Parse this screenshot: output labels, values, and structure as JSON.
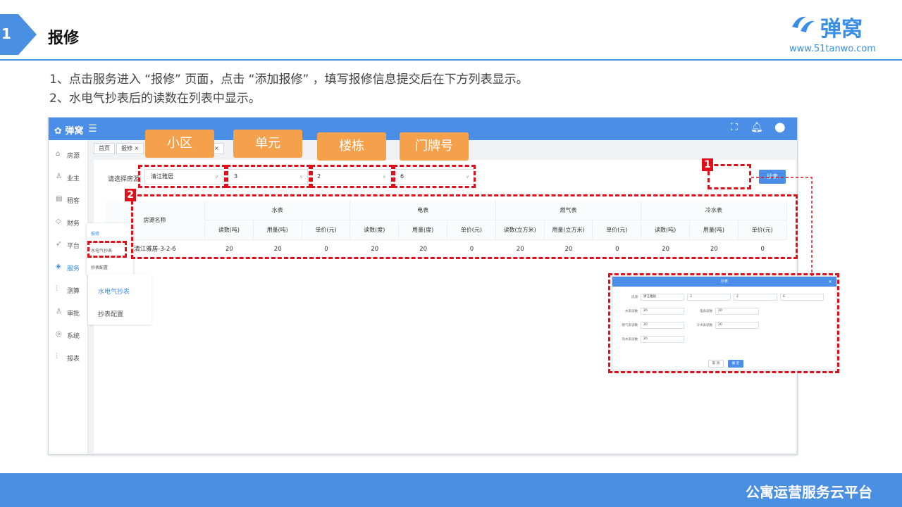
{
  "slide": {
    "number": "1",
    "title": "报修",
    "logo_name": "弹窝",
    "logo_url": "www.51tanwo.com",
    "notes": [
      "1、点击服务进入 “报修” 页面，点击 “添加报修” ，填写报修信息提交后在下方列表显示。",
      "2、水电气抄表后的读数在列表中显示。"
    ],
    "footer": "公寓运营服务云平台"
  },
  "tags": [
    "小区",
    "单元",
    "楼栋",
    "门牌号"
  ],
  "badges": [
    "1",
    "2"
  ],
  "app": {
    "brand": "弹窝",
    "sidebar": [
      "房源",
      "业主",
      "租客",
      "财务",
      "平台",
      "服务",
      "测算",
      "审批",
      "系统",
      "报表"
    ],
    "sidebar_icons": [
      "home-icon",
      "user-icon",
      "database-icon",
      "diamond-icon",
      "send-icon",
      "tag-icon",
      "sliders-icon",
      "person-icon",
      "settings-icon",
      "sliders-icon"
    ],
    "breadcrumbs": [
      "首页",
      "报修 ×",
      "×"
    ],
    "filter": {
      "label": "请选择房源",
      "community": "清江雅居",
      "unit": "3",
      "building": "2",
      "room": "6"
    },
    "buttons": {
      "meter": "抄表"
    },
    "popmenu": [
      "报修",
      "水电气抄表",
      "抄表配置"
    ],
    "submenu": [
      "水电气抄表",
      "抄表配置"
    ],
    "table": {
      "name_header": "房源名称",
      "groups": [
        "水表",
        "电表",
        "燃气表",
        "冷水表"
      ],
      "sub_headers": [
        "读数(吨)",
        "用量(吨)",
        "单价(元)",
        "读数(度)",
        "用量(度)",
        "单价(元)",
        "读数(立方米)",
        "用量(立方米)",
        "单价(元)",
        "读数(吨)",
        "用量(吨)",
        "单价(元)"
      ],
      "row_name": "清江雅居-3-2-6",
      "row_values": [
        "20",
        "20",
        "0",
        "20",
        "20",
        "0",
        "20",
        "20",
        "0",
        "20",
        "20",
        "0"
      ]
    }
  },
  "dialog": {
    "title": "抄表",
    "labels": [
      "房源",
      "水表读数",
      "电表读数",
      "燃气表读数",
      "冷水表读数",
      "热水表读数"
    ],
    "house": [
      "清江雅居",
      "3",
      "2",
      "6"
    ],
    "values": [
      "20",
      "20",
      "20",
      "20",
      "20"
    ],
    "cancel": "取 消",
    "confirm": "确 定"
  }
}
